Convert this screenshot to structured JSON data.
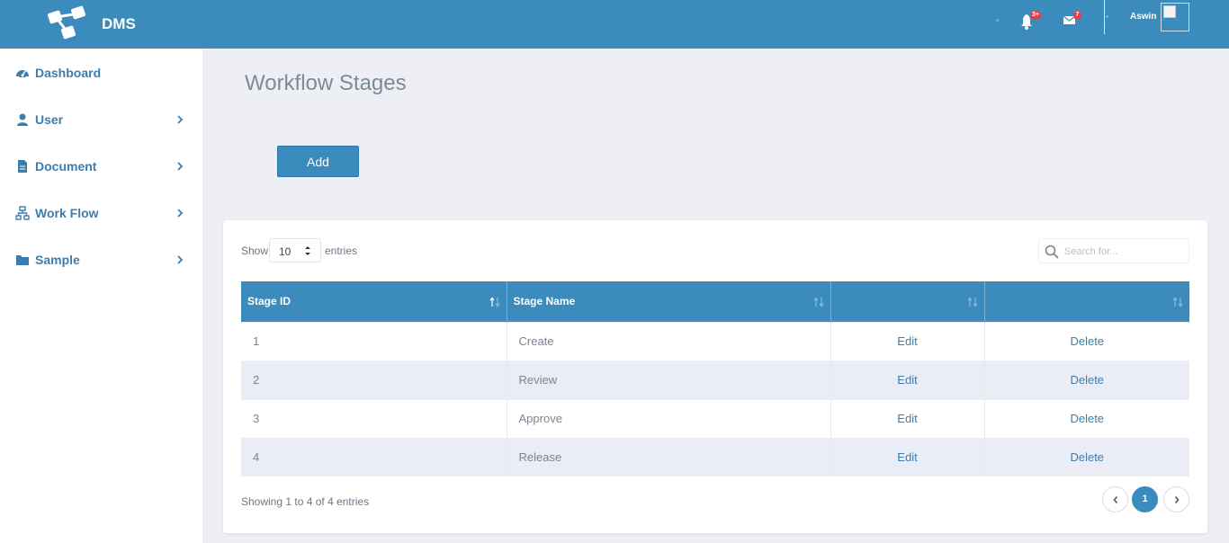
{
  "header": {
    "brand": "DMS",
    "notifications_badge": "3+",
    "messages_badge": "7",
    "username": "Aswin"
  },
  "sidebar": {
    "items": [
      {
        "label": "Dashboard",
        "icon": "tachometer-icon",
        "has_children": false
      },
      {
        "label": "User",
        "icon": "user-icon",
        "has_children": true
      },
      {
        "label": "Document",
        "icon": "file-icon",
        "has_children": true
      },
      {
        "label": "Work Flow",
        "icon": "sitemap-icon",
        "has_children": true
      },
      {
        "label": "Sample",
        "icon": "folder-icon",
        "has_children": true
      }
    ]
  },
  "main": {
    "title": "Workflow Stages",
    "add_label": "Add"
  },
  "table_controls": {
    "show_label": "Show",
    "page_length": "10",
    "entries_label": "entries",
    "search_placeholder": "Search for..."
  },
  "table": {
    "columns": [
      "Stage ID",
      "Stage Name",
      "",
      ""
    ],
    "rows": [
      {
        "id": "1",
        "name": "Create",
        "edit": "Edit",
        "delete": "Delete"
      },
      {
        "id": "2",
        "name": "Review",
        "edit": "Edit",
        "delete": "Delete"
      },
      {
        "id": "3",
        "name": "Approve",
        "edit": "Edit",
        "delete": "Delete"
      },
      {
        "id": "4",
        "name": "Release",
        "edit": "Edit",
        "delete": "Delete"
      }
    ]
  },
  "footer": {
    "info": "Showing 1 to 4 of 4 entries",
    "current_page": "1"
  },
  "colors": {
    "primary": "#3b8bbd",
    "page_bg": "#eeeff4",
    "row_stripe": "#eaecf6",
    "badge": "#e0404b"
  }
}
